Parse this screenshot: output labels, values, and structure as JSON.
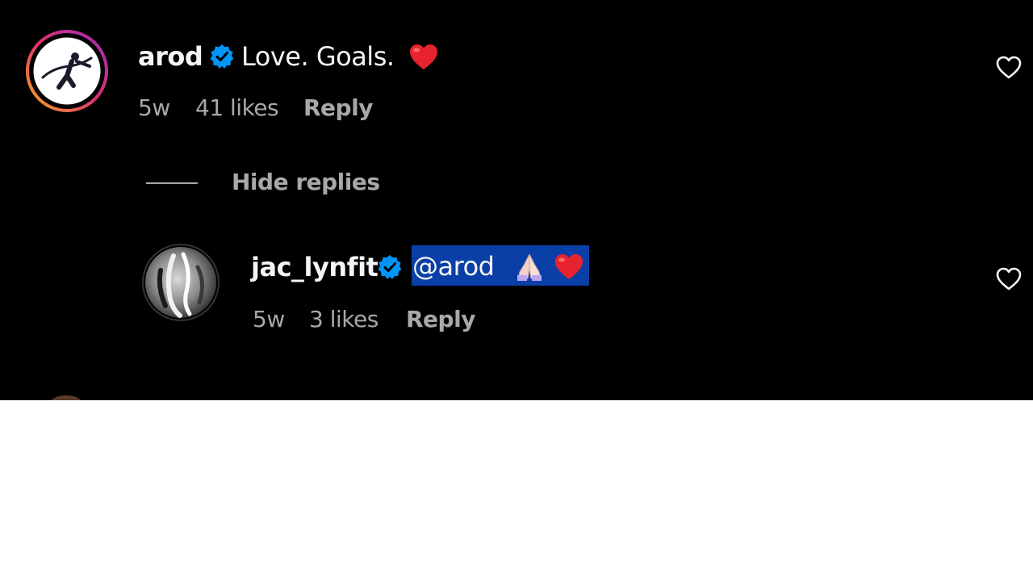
{
  "comments": [
    {
      "username": "arod",
      "text": "Love. Goals.",
      "age": "5w",
      "likes": "41 likes",
      "reply_label": "Reply",
      "avatar_icon": "pitcher-logo-avatar-icon",
      "verified_icon": "verified-badge-icon",
      "emoji": [
        "red-heart-emoji"
      ],
      "like_icon": "heart-outline-icon"
    }
  ],
  "replies_toggle": "Hide replies",
  "replies": [
    {
      "username": "jac_lynfit",
      "text": "@arod",
      "age": "5w",
      "likes": "3 likes",
      "reply_label": "Reply",
      "avatar_icon": "profile-photo-avatar-icon",
      "verified_icon": "verified-badge-icon",
      "emoji": [
        "folded-hands-emoji",
        "red-heart-emoji"
      ],
      "text_selected": true,
      "like_icon": "heart-outline-icon"
    }
  ],
  "colors": {
    "background": "#000000",
    "primary_text": "#f5f5f5",
    "secondary_text": "#a8a8a8",
    "verified_blue": "#0095f6",
    "selection": "#0b3fa8",
    "heart_red": "#e8232f"
  }
}
